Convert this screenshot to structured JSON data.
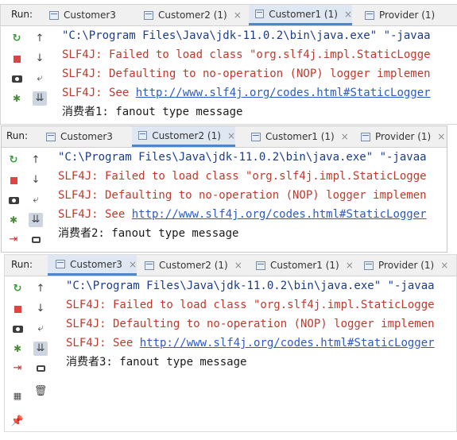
{
  "run_label": "Run:",
  "colors": {
    "accent": "#4a88c7",
    "error_text": "#c0392b",
    "command_text": "#1b3c8c",
    "link_text": "#2c5bc4"
  },
  "tool_icons": [
    "rerun-icon",
    "stop-icon",
    "camera-icon",
    "debug-icon",
    "exit-icon",
    "up-arrow-icon",
    "down-arrow-icon",
    "soft-wrap-icon",
    "scroll-to-end-icon",
    "print-icon",
    "layout-icon",
    "trash-icon",
    "pin-icon"
  ],
  "panels": [
    {
      "tabs": [
        {
          "label": "Customer3",
          "active": false
        },
        {
          "label": "Customer2 (1)",
          "active": false,
          "close": "×"
        },
        {
          "label": "Customer1 (1)",
          "active": true,
          "close": "×"
        },
        {
          "label": "Provider (1)",
          "active": false
        }
      ],
      "lines": {
        "cmd": "\"C:\\Program Files\\Java\\jdk-11.0.2\\bin\\java.exe\" \"-javaa",
        "failed": "SLF4J: Failed to load class \"org.slf4j.impl.StaticLogge",
        "default": "SLF4J: Defaulting to no-operation (NOP) logger implemen",
        "see_prefix": "SLF4J: See ",
        "see_link": "http://www.slf4j.org/codes.html#StaticLogger",
        "output": "消费者1: fanout type message"
      }
    },
    {
      "tabs": [
        {
          "label": "Customer3",
          "active": false
        },
        {
          "label": "Customer2 (1)",
          "active": true,
          "close": "×"
        },
        {
          "label": "Customer1 (1)",
          "active": false,
          "close": "×"
        },
        {
          "label": "Provider (1)",
          "active": false,
          "close": "×"
        }
      ],
      "lines": {
        "cmd": "\"C:\\Program Files\\Java\\jdk-11.0.2\\bin\\java.exe\" \"-javaa",
        "failed": "SLF4J: Failed to load class \"org.slf4j.impl.StaticLogge",
        "default": "SLF4J: Defaulting to no-operation (NOP) logger implemen",
        "see_prefix": "SLF4J: See ",
        "see_link": "http://www.slf4j.org/codes.html#StaticLogger",
        "output": "消费者2: fanout type message"
      }
    },
    {
      "tabs": [
        {
          "label": "Customer3",
          "active": true,
          "close": "×"
        },
        {
          "label": "Customer2 (1)",
          "active": false,
          "close": "×"
        },
        {
          "label": "Customer1 (1)",
          "active": false,
          "close": "×"
        },
        {
          "label": "Provider (1)",
          "active": false,
          "close": "×"
        }
      ],
      "lines": {
        "cmd": "\"C:\\Program Files\\Java\\jdk-11.0.2\\bin\\java.exe\" \"-javaa",
        "failed": "SLF4J: Failed to load class \"org.slf4j.impl.StaticLogge",
        "default": "SLF4J: Defaulting to no-operation (NOP) logger implemen",
        "see_prefix": "SLF4J: See ",
        "see_link": "http://www.slf4j.org/codes.html#StaticLogger",
        "output": "消费者3: fanout type message"
      }
    }
  ]
}
